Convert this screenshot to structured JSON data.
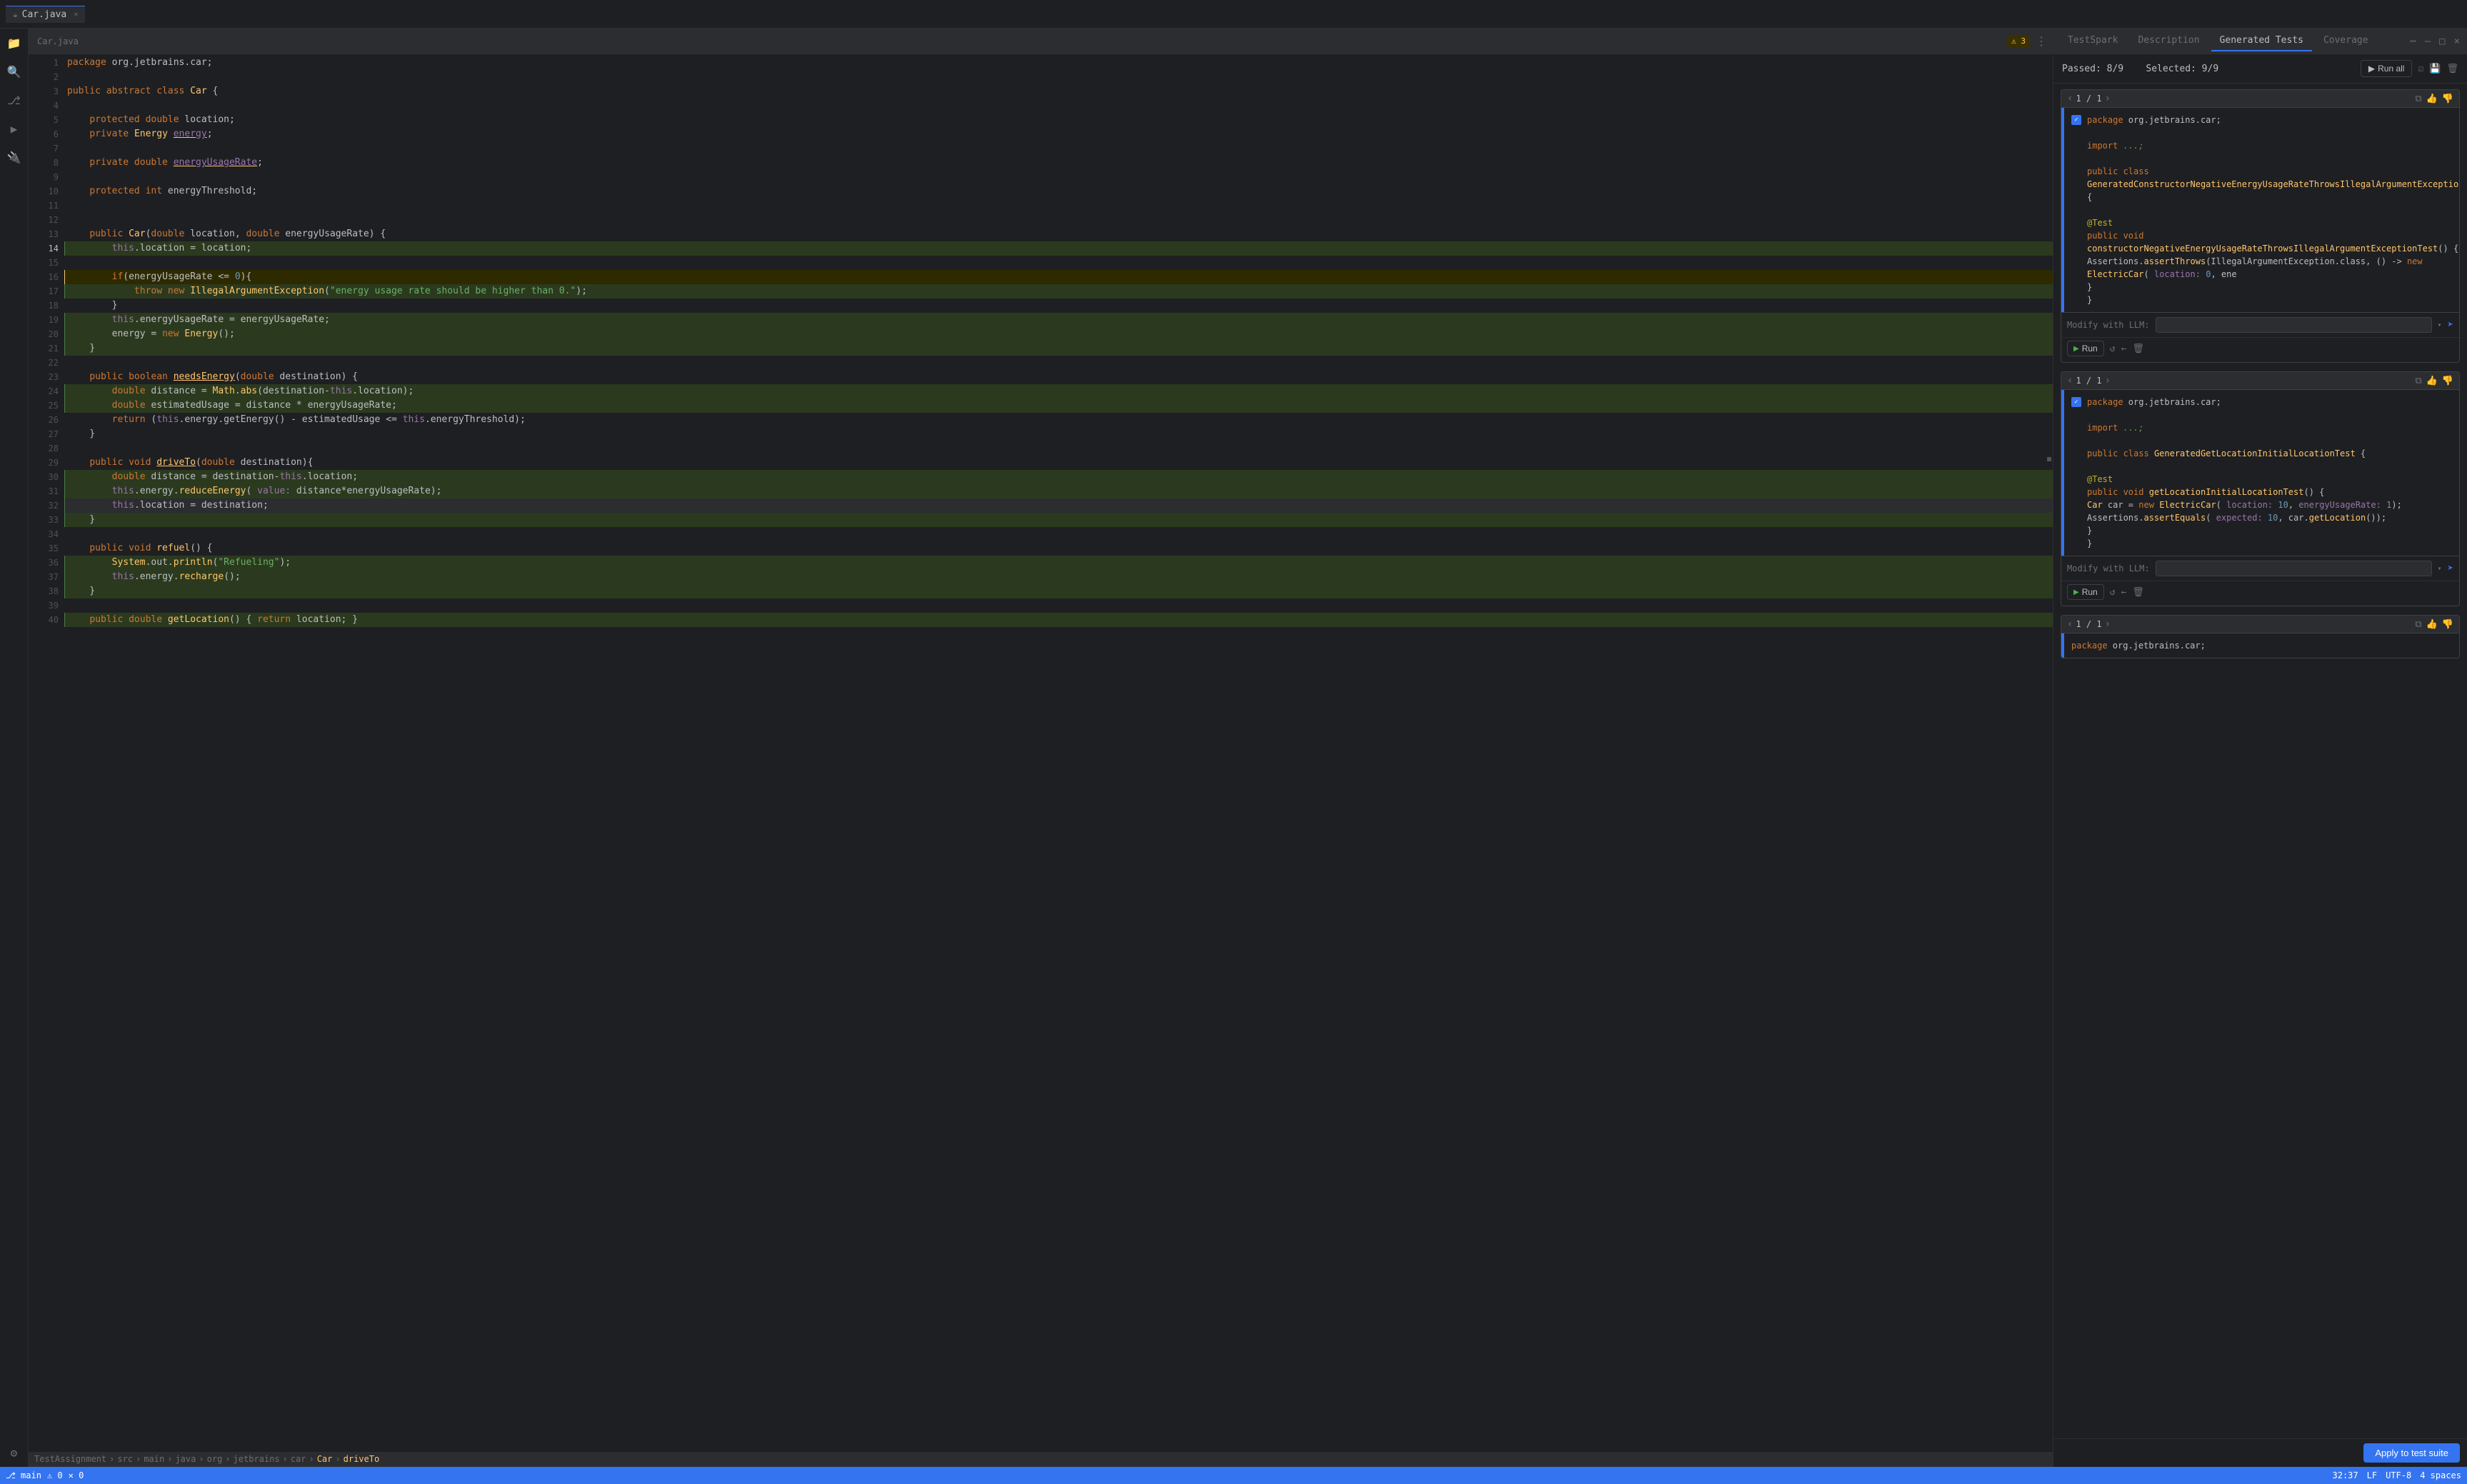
{
  "window": {
    "tab_label": "Car.java",
    "close_icon": "×"
  },
  "tabs": {
    "testspark": "TestSpark",
    "description": "Description",
    "generated_tests": "Generated Tests",
    "coverage": "Coverage"
  },
  "panel_header": {
    "passed": "Passed: 8/9",
    "selected": "Selected: 9/9",
    "run_all": "Run all"
  },
  "test_card_1": {
    "nav": "1 / 1",
    "code_lines": [
      "package org.jetbrains.car;",
      "",
      "import ...;",
      "",
      "public class GeneratedConstructorNegativeEnergyUsageRateThrowsIllegalArgumentExceptionTest {",
      "",
      "    @Test",
      "    public void constructorNegativeEnergyUsageRateThrowsIllegalArgumentExceptionTest() {",
      "        Assertions.assertThrows(IllegalArgumentException.class, () -> new ElectricCar( location: 0,  ene",
      "    }",
      "}"
    ],
    "modify_label": "Modify with LLM:",
    "run_label": "Run"
  },
  "test_card_2": {
    "nav": "1 / 1",
    "code_lines": [
      "package org.jetbrains.car;",
      "",
      "import ...;",
      "",
      "public class GeneratedGetLocationInitialLocationTest {",
      "",
      "    @Test",
      "    public void getLocationInitialLocationTest() {",
      "        Car car = new ElectricCar( location: 10,  energyUsageRate: 1);",
      "        Assertions.assertEquals( expected: 10,  car.getLocation());",
      "    }",
      "}"
    ],
    "modify_label": "Modify with LLM:",
    "run_label": "Run"
  },
  "test_card_3": {
    "nav": "1 / 1",
    "partial_code": "package org.jetbrains.car;"
  },
  "apply_btn": "Apply to test suite",
  "editor": {
    "lines": [
      {
        "num": 1,
        "code": "package org.jetbrains.car;",
        "marker": "none"
      },
      {
        "num": 2,
        "code": "",
        "marker": "none"
      },
      {
        "num": 3,
        "code": "public abstract class Car {",
        "marker": "none"
      },
      {
        "num": 4,
        "code": "",
        "marker": "none"
      },
      {
        "num": 5,
        "code": "    protected double location;",
        "marker": "none"
      },
      {
        "num": 6,
        "code": "    private Energy energy;",
        "marker": "none"
      },
      {
        "num": 7,
        "code": "",
        "marker": "none"
      },
      {
        "num": 8,
        "code": "    private double energyUsageRate;",
        "marker": "none"
      },
      {
        "num": 9,
        "code": "",
        "marker": "none"
      },
      {
        "num": 10,
        "code": "    protected int energyThreshold;",
        "marker": "none"
      },
      {
        "num": 11,
        "code": "",
        "marker": "none"
      },
      {
        "num": 12,
        "code": "",
        "marker": "none"
      },
      {
        "num": 13,
        "code": "    public Car(double location, double energyUsageRate) {",
        "marker": "none"
      },
      {
        "num": 14,
        "code": "        this.location = location;",
        "marker": "green"
      },
      {
        "num": 15,
        "code": "",
        "marker": "none"
      },
      {
        "num": 16,
        "code": "        if(energyUsageRate <= 0){",
        "marker": "yellow"
      },
      {
        "num": 17,
        "code": "            throw new IllegalArgumentException(\"energy usage rate should be higher than 0.\");",
        "marker": "green"
      },
      {
        "num": 18,
        "code": "        }",
        "marker": "none"
      },
      {
        "num": 19,
        "code": "        this.energyUsageRate = energyUsageRate;",
        "marker": "green"
      },
      {
        "num": 20,
        "code": "        energy = new Energy();",
        "marker": "green"
      },
      {
        "num": 21,
        "code": "    }",
        "marker": "green"
      },
      {
        "num": 22,
        "code": "",
        "marker": "none"
      },
      {
        "num": 23,
        "code": "    public boolean needsEnergy(double destination) {",
        "marker": "none"
      },
      {
        "num": 24,
        "code": "        double distance = Math.abs(destination-this.location);",
        "marker": "green"
      },
      {
        "num": 25,
        "code": "        double estimatedUsage = distance * energyUsageRate;",
        "marker": "green"
      },
      {
        "num": 26,
        "code": "        return (this.energy.getEnergy() - estimatedUsage <= this.energyThreshold);",
        "marker": "none"
      },
      {
        "num": 27,
        "code": "    }",
        "marker": "none"
      },
      {
        "num": 28,
        "code": "",
        "marker": "none"
      },
      {
        "num": 29,
        "code": "    public void driveTo(double destination){",
        "marker": "none"
      },
      {
        "num": 30,
        "code": "        double distance = destination-this.location;",
        "marker": "green"
      },
      {
        "num": 31,
        "code": "        this.energy.reduceEnergy( value: distance*energyUsageRate);",
        "marker": "green"
      },
      {
        "num": 32,
        "code": "        this.location = destination;",
        "marker": "green"
      },
      {
        "num": 33,
        "code": "    }",
        "marker": "green"
      },
      {
        "num": 34,
        "code": "",
        "marker": "none"
      },
      {
        "num": 35,
        "code": "    public void refuel() {",
        "marker": "none"
      },
      {
        "num": 36,
        "code": "        System.out.println(\"Refueling\");",
        "marker": "green"
      },
      {
        "num": 37,
        "code": "        this.energy.recharge();",
        "marker": "green"
      },
      {
        "num": 38,
        "code": "    }",
        "marker": "green"
      },
      {
        "num": 39,
        "code": "",
        "marker": "none"
      },
      {
        "num": 40,
        "code": "    public double getLocation() { return location; }",
        "marker": "green"
      }
    ]
  },
  "breadcrumb": {
    "items": [
      "TestAssignment",
      "src",
      "main",
      "java",
      "org",
      "jetbrains",
      "car",
      "Car",
      "driveTo"
    ]
  },
  "status_bar": {
    "line_col": "32:37",
    "line_ending": "LF",
    "encoding": "UTF-8",
    "indent": "4 spaces"
  }
}
